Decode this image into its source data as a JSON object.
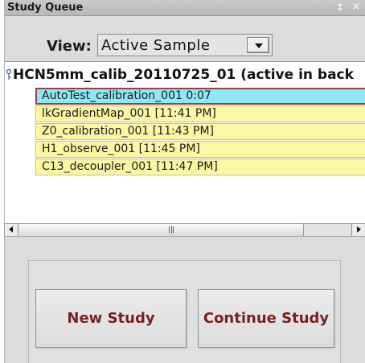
{
  "panel": {
    "title": "Study Queue",
    "pin_icon": "pin-icon",
    "close_icon": "close-icon",
    "pin_glyph": "↕",
    "close_glyph": "×"
  },
  "view": {
    "label": "View:",
    "selected": "Active Sample"
  },
  "tree": {
    "root_label": "HCN5mm_calib_20110725_01 (active in back",
    "items": [
      {
        "label": "AutoTest_calibration_001 0:07",
        "selected": true
      },
      {
        "label": "lkGradientMap_001 [11:41 PM]",
        "selected": false
      },
      {
        "label": "Z0_calibration_001 [11:43 PM]",
        "selected": false
      },
      {
        "label": "H1_observe_001 [11:45 PM]",
        "selected": false
      },
      {
        "label": "C13_decoupler_001 [11:47 PM]",
        "selected": false
      }
    ]
  },
  "buttons": {
    "new_study": "New Study",
    "continue_study": "Continue Study"
  },
  "colors": {
    "queued_item": "#fbf7a4",
    "active_item": "#8de8f3",
    "button_text": "#7a1f1f"
  }
}
